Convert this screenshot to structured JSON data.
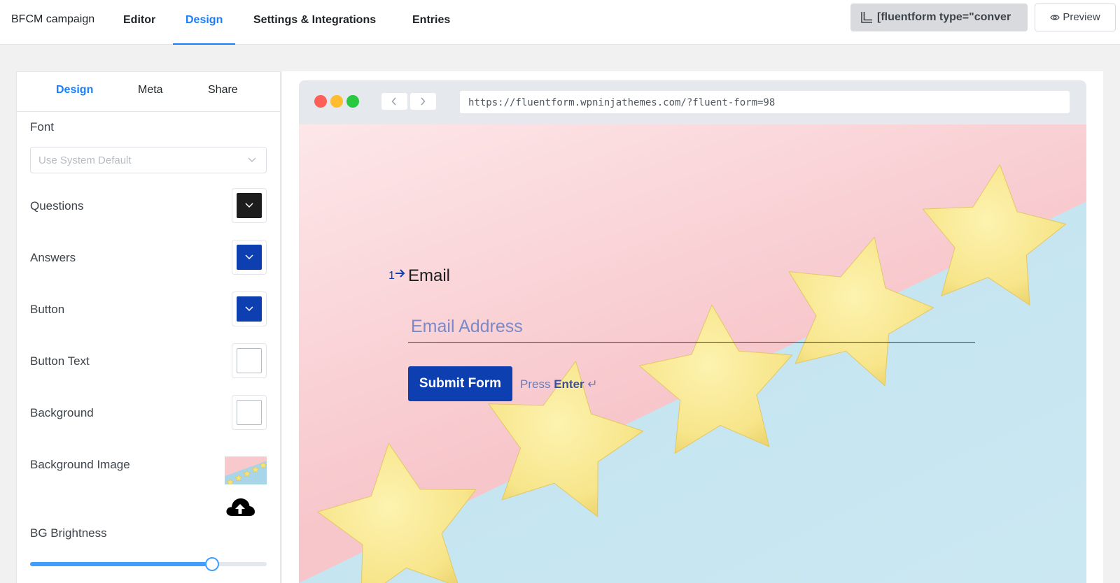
{
  "header": {
    "brand": "BFCM campaign",
    "tabs": [
      {
        "label": "Editor"
      },
      {
        "label": "Design"
      },
      {
        "label": "Settings & Integrations"
      },
      {
        "label": "Entries"
      }
    ],
    "shortcode": "[fluentform type=\"conver",
    "preview_label": "Preview"
  },
  "design_panel": {
    "tabs": [
      {
        "label": "Design"
      },
      {
        "label": "Meta"
      },
      {
        "label": "Share"
      }
    ],
    "font": {
      "label": "Font",
      "placeholder": "Use System Default"
    },
    "colors": [
      {
        "label": "Questions",
        "color": "#1d1d1d"
      },
      {
        "label": "Answers",
        "color": "#0d3fb0"
      },
      {
        "label": "Button",
        "color": "#0d3fb0"
      },
      {
        "label": "Button Text",
        "color": "#ffffff"
      },
      {
        "label": "Background",
        "color": "#ffffff"
      }
    ],
    "background_image": {
      "label": "Background Image",
      "icon": "cloud-upload-icon"
    },
    "brightness": {
      "label": "BG Brightness",
      "value_fraction": 0.77
    }
  },
  "preview": {
    "url": "https://fluentform.wpninjathemes.com/?fluent-form=98",
    "question_number": "1",
    "question_title": "Email",
    "input_placeholder": "Email Address",
    "submit_label": "Submit Form",
    "press_label": "Press",
    "enter_label": "Enter",
    "enter_symbol": "↵",
    "window_dots": [
      "#fe5f57",
      "#febc2e",
      "#28c840"
    ]
  }
}
